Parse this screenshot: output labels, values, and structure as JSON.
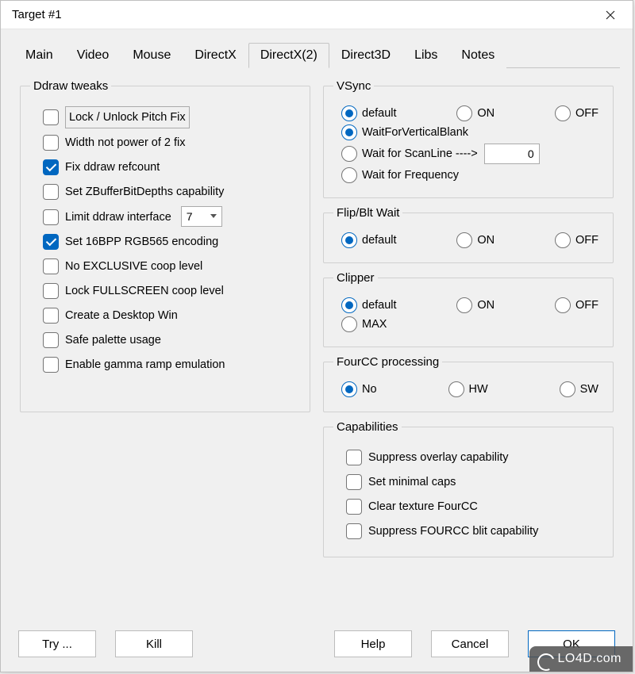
{
  "window": {
    "title": "Target #1"
  },
  "tabs": [
    "Main",
    "Video",
    "Mouse",
    "DirectX",
    "DirectX(2)",
    "Direct3D",
    "Libs",
    "Notes"
  ],
  "active_tab": 4,
  "ddraw": {
    "legend": "Ddraw tweaks",
    "items": [
      {
        "label": "Lock / Unlock Pitch Fix",
        "checked": false,
        "boxed": true
      },
      {
        "label": "Width not power of 2 fix",
        "checked": false
      },
      {
        "label": "Fix ddraw refcount",
        "checked": true
      },
      {
        "label": "Set ZBufferBitDepths capability",
        "checked": false
      },
      {
        "label": "Limit ddraw interface",
        "checked": false,
        "select": "7"
      },
      {
        "label": "Set 16BPP RGB565 encoding",
        "checked": true
      },
      {
        "label": "No EXCLUSIVE coop level",
        "checked": false
      },
      {
        "label": "Lock FULLSCREEN coop level",
        "checked": false
      },
      {
        "label": "Create a Desktop Win",
        "checked": false
      },
      {
        "label": "Safe palette usage",
        "checked": false
      },
      {
        "label": "Enable gamma ramp emulation",
        "checked": false
      }
    ]
  },
  "vsync": {
    "legend": "VSync",
    "row1": [
      {
        "label": "default",
        "selected": true
      },
      {
        "label": "ON",
        "selected": false
      },
      {
        "label": "OFF",
        "selected": false
      }
    ],
    "row2": {
      "label": "WaitForVerticalBlank",
      "selected": true
    },
    "row3": {
      "label": "Wait for ScanLine ---->",
      "selected": false,
      "value": "0"
    },
    "row4": {
      "label": "Wait for Frequency",
      "selected": false
    }
  },
  "flip": {
    "legend": "Flip/Blt Wait",
    "row1": [
      {
        "label": "default",
        "selected": true
      },
      {
        "label": "ON",
        "selected": false
      },
      {
        "label": "OFF",
        "selected": false
      }
    ]
  },
  "clipper": {
    "legend": "Clipper",
    "row1": [
      {
        "label": "default",
        "selected": true
      },
      {
        "label": "ON",
        "selected": false
      },
      {
        "label": "OFF",
        "selected": false
      }
    ],
    "row2": {
      "label": "MAX",
      "selected": false
    }
  },
  "fourcc": {
    "legend": "FourCC processing",
    "row1": [
      {
        "label": "No",
        "selected": true
      },
      {
        "label": "HW",
        "selected": false
      },
      {
        "label": "SW",
        "selected": false
      }
    ]
  },
  "caps": {
    "legend": "Capabilities",
    "items": [
      {
        "label": "Suppress overlay capability",
        "checked": false
      },
      {
        "label": "Set minimal caps",
        "checked": false
      },
      {
        "label": "Clear texture FourCC",
        "checked": false
      },
      {
        "label": "Suppress FOURCC blit capability",
        "checked": false
      }
    ]
  },
  "buttons": {
    "try": "Try ...",
    "kill": "Kill",
    "help": "Help",
    "cancel": "Cancel",
    "ok": "OK"
  },
  "watermark": "LO4D.com"
}
